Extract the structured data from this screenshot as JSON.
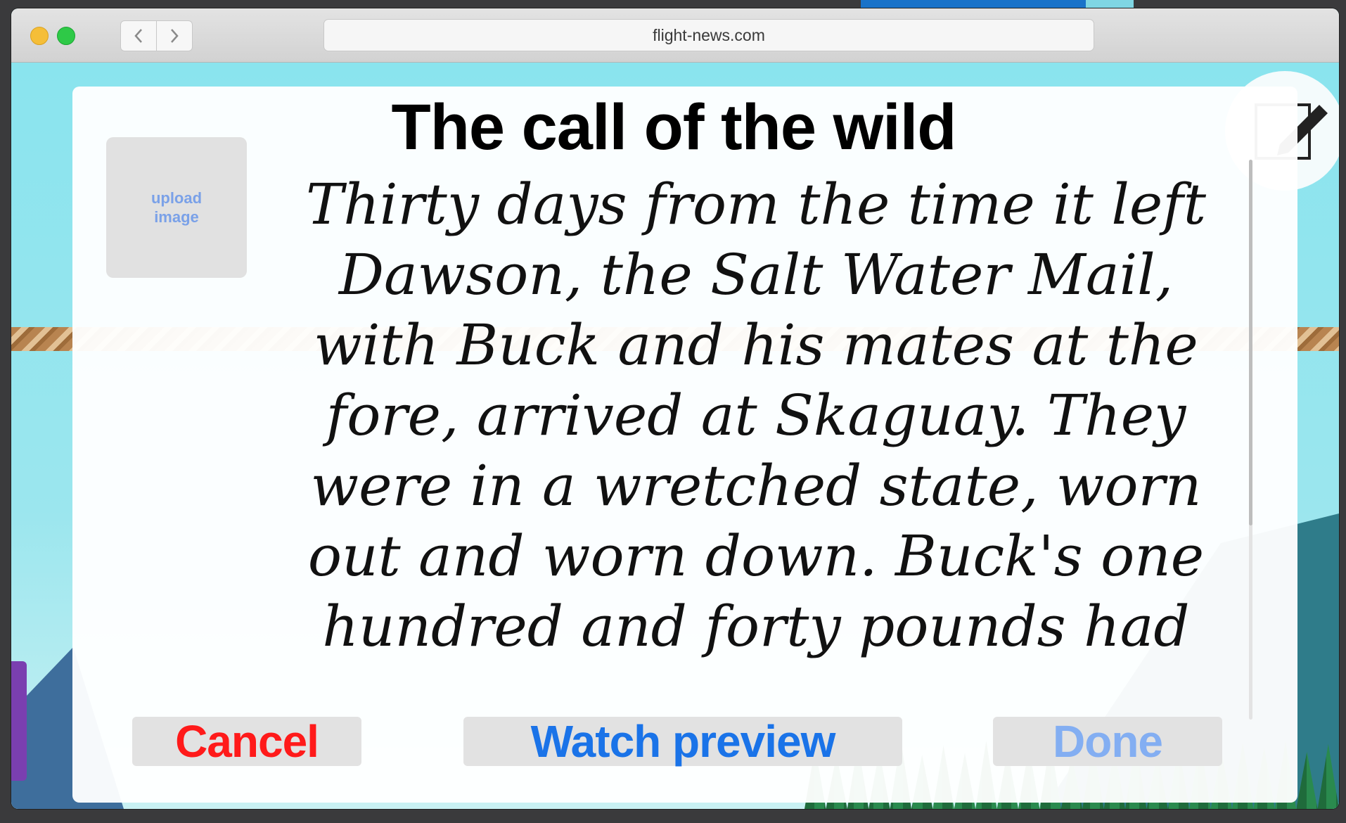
{
  "browser": {
    "url": "flight-news.com",
    "back_icon": "chevron-left-icon",
    "forward_icon": "chevron-right-icon"
  },
  "modal": {
    "title": "The call of the wild",
    "upload_label_line1": "upload",
    "upload_label_line2": "image",
    "story_text": "Thirty days from the time it left Dawson, the Salt Water Mail, with Buck and his mates at the fore, arrived at Skaguay. They were in a wretched state, worn out and worn down. Buck's one hundred and forty pounds had",
    "buttons": {
      "cancel": "Cancel",
      "preview": "Watch preview",
      "done": "Done"
    }
  },
  "colors": {
    "cancel": "#ff1a1a",
    "preview": "#1a73e8",
    "done": "#83aef2",
    "page_background": "#8ae4ee"
  }
}
